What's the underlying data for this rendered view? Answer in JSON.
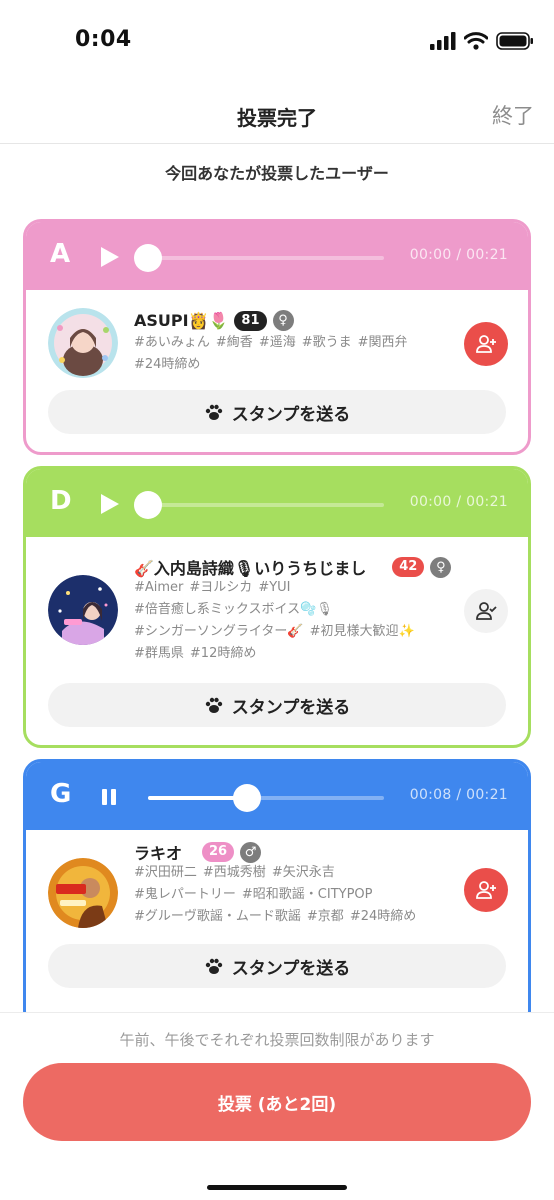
{
  "status_bar": {
    "time": "0:04"
  },
  "nav": {
    "title": "投票完了",
    "end": "終了"
  },
  "subtitle": "今回あなたが投票したユーザー",
  "cards": [
    {
      "letter": "A",
      "theme_color": "#ee9bcb",
      "player_state": "paused",
      "current": "00:00",
      "total": "00:21",
      "progress": 0.0,
      "user": {
        "name": "ASUPI👸🌷",
        "age": "81",
        "age_color": "#222222",
        "gender": "♀",
        "tags": [
          "#あいみょん",
          "#絢香",
          "#遥海",
          "#歌うま",
          "#関西弁",
          "#24時締め"
        ],
        "follow_state": "follow"
      },
      "stamp_label": "スタンプを送る"
    },
    {
      "letter": "D",
      "theme_color": "#a6de5f",
      "player_state": "paused",
      "current": "00:00",
      "total": "00:21",
      "progress": 0.0,
      "user": {
        "name": "🎸入内島詩織🎙いりうちじまし",
        "age": "42",
        "age_color": "#ea4e4a",
        "gender": "♀",
        "tags": [
          "#Aimer",
          "#ヨルシカ",
          "#YUI",
          "#倍音癒し系ミックスボイス🫧🎙",
          "#シンガーソングライター🎸",
          "#初見様大歓迎✨",
          "#群馬県",
          "#12時締め"
        ],
        "follow_state": "following"
      },
      "stamp_label": "スタンプを送る"
    },
    {
      "letter": "G",
      "theme_color": "#3f87ee",
      "player_state": "playing",
      "current": "00:08",
      "total": "00:21",
      "progress": 0.42,
      "user": {
        "name": "ラキオ",
        "age": "26",
        "age_color": "#ee8fc6",
        "gender": "♂",
        "tags": [
          "#沢田研二",
          "#西城秀樹",
          "#矢沢永吉",
          "#鬼レパートリー",
          "#昭和歌謡・CITYPOP",
          "#グルーヴ歌謡・ムード歌謡",
          "#京都",
          "#24時締め"
        ],
        "follow_state": "follow"
      },
      "stamp_label": "スタンプを送る"
    }
  ],
  "footer": {
    "notice": "午前、午後でそれぞれ投票回数制限があります",
    "vote_button": "投票 (あと2回)"
  },
  "colors": {
    "accent": "#ed6a63",
    "follow": "#ea4e4a"
  }
}
